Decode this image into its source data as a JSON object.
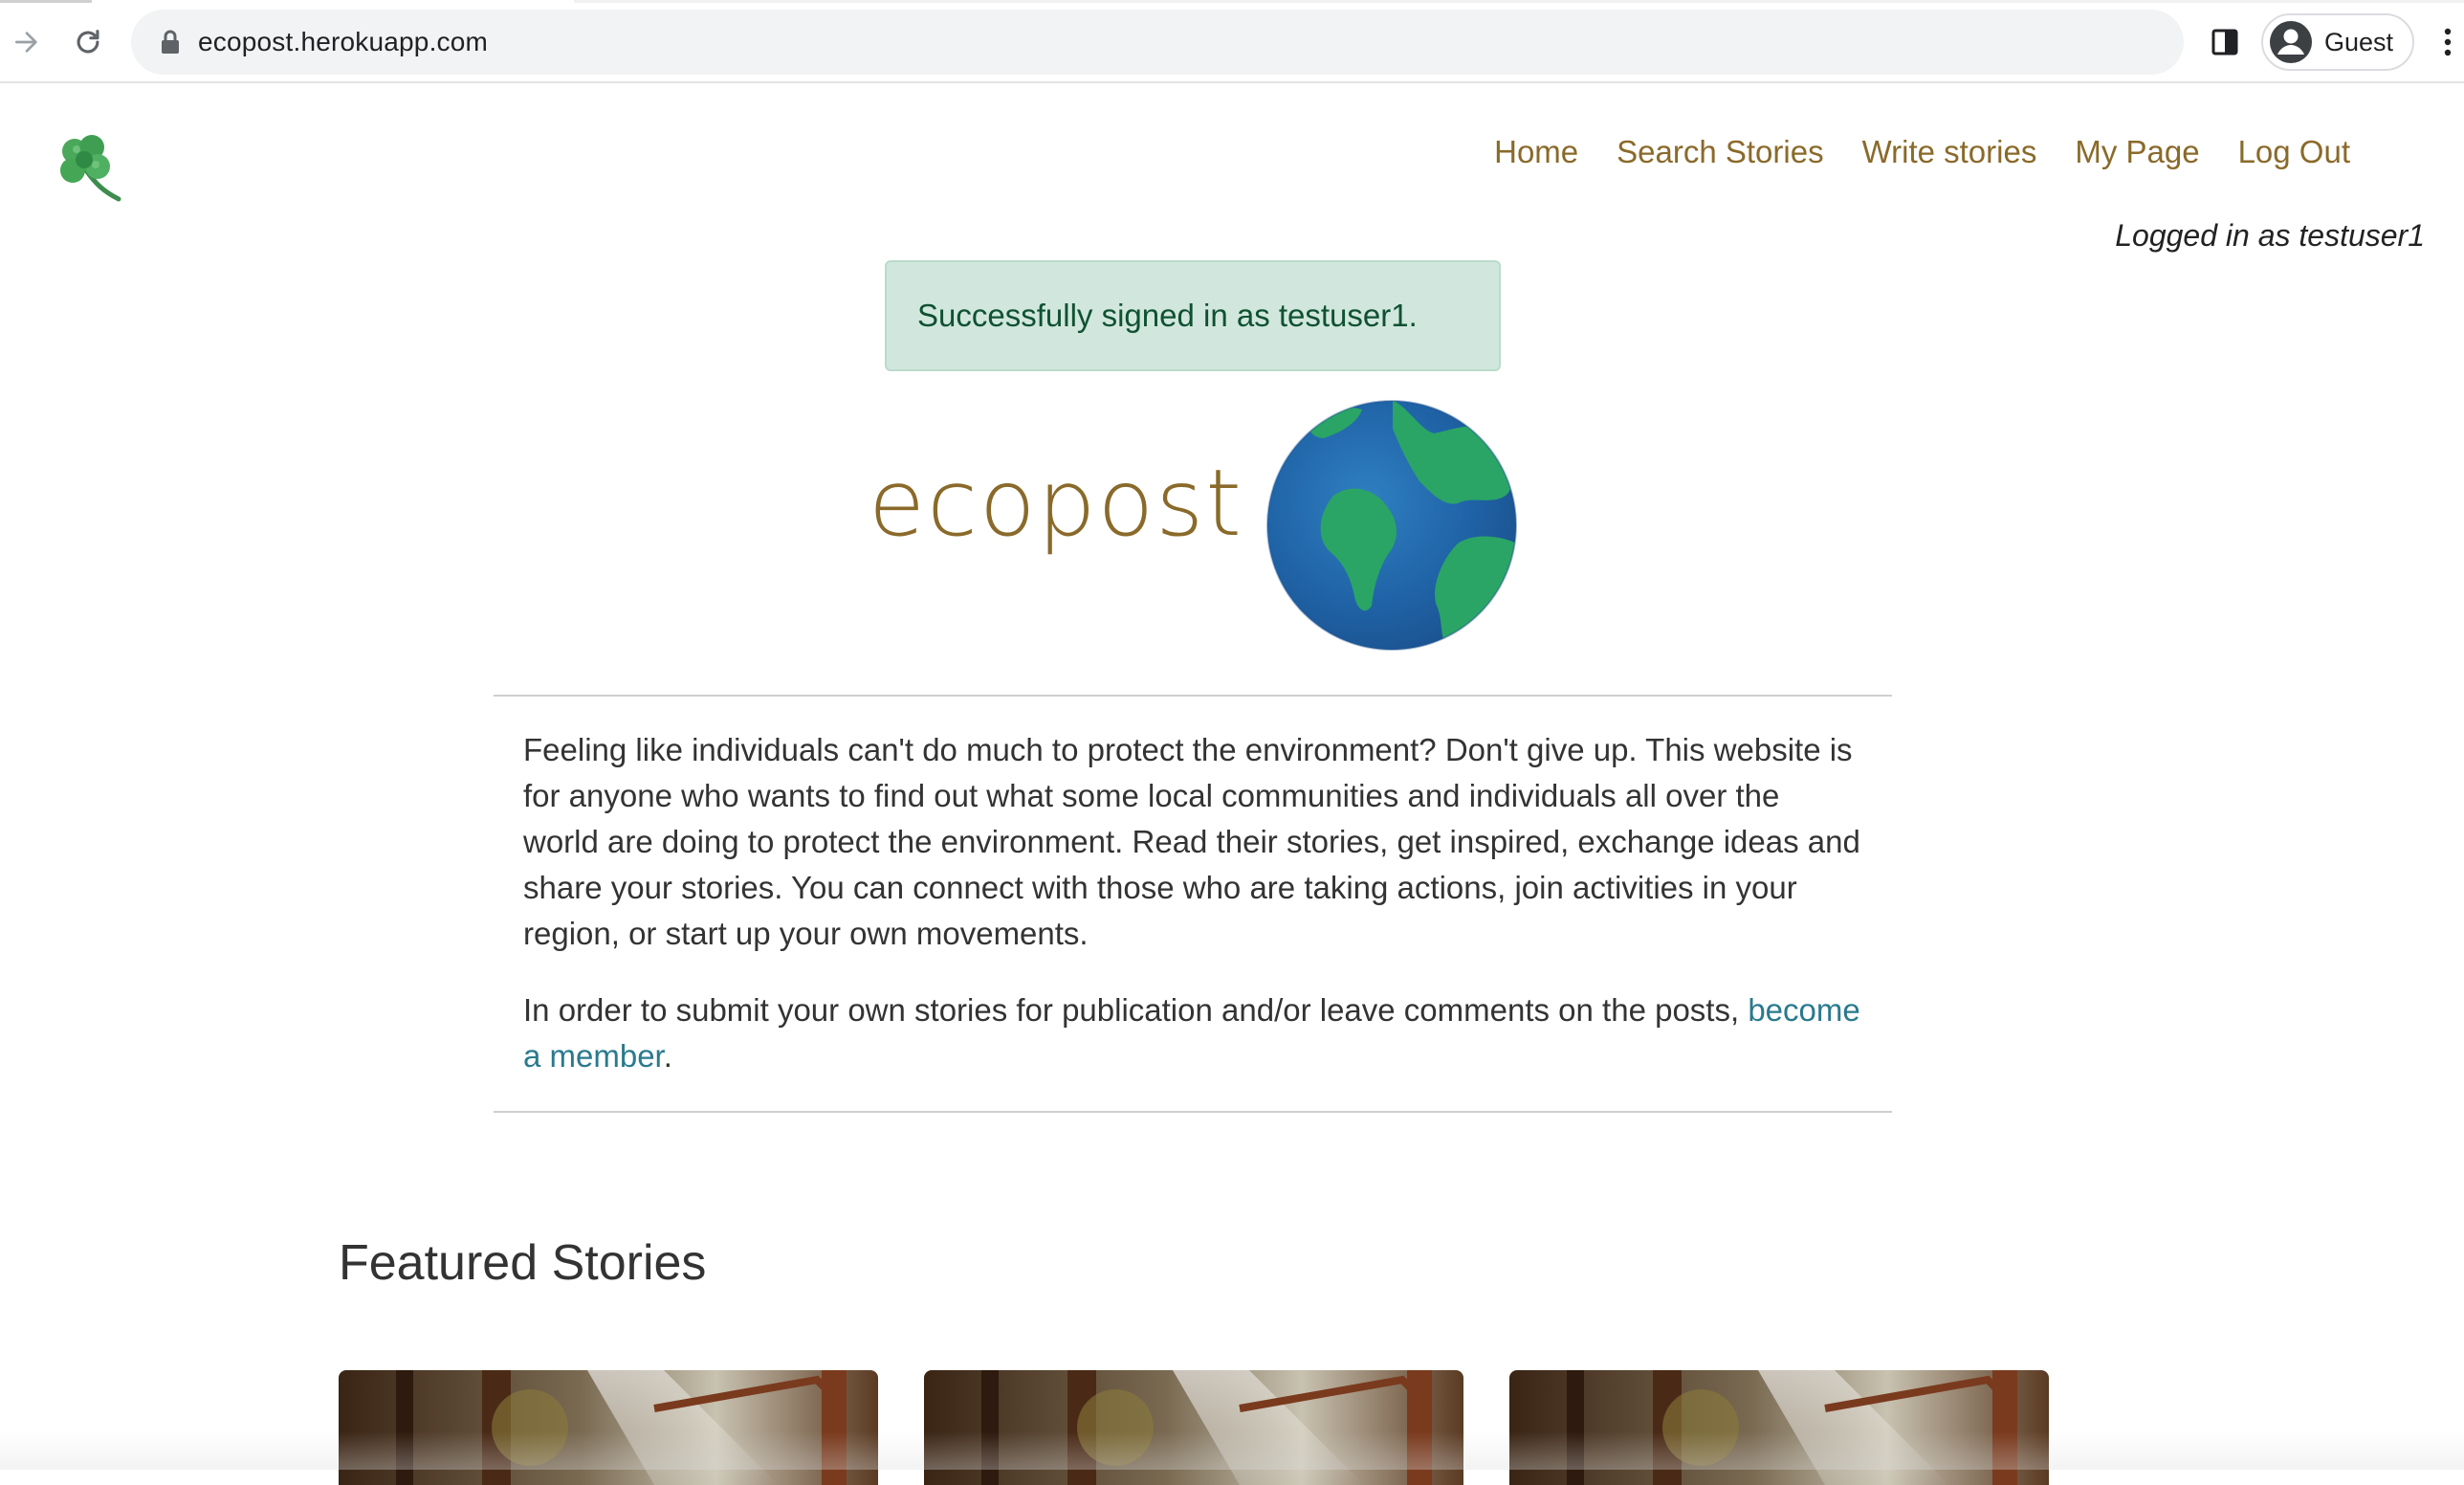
{
  "browser": {
    "url": "ecopost.herokuapp.com",
    "profile_name": "Guest"
  },
  "site": {
    "nav": {
      "home": "Home",
      "search": "Search Stories",
      "write": "Write stories",
      "my_page": "My Page",
      "logout": "Log Out"
    },
    "logged_in": "Logged in as testuser1",
    "alert": "Successfully signed in as testuser1.",
    "wordmark": "ecopost",
    "intro": {
      "p1": "Feeling like individuals can't do much to protect the environment? Don't give up. This website is for anyone who wants to find out what some local communities and individuals all over the world are doing to protect the environment. Read their stories, get inspired, exchange ideas and share your stories. You can connect with those who are taking actions, join activities in your region, or start up your own movements.",
      "p2_before": "In order to submit your own stories for publication and/or leave comments on the posts, ",
      "p2_link": "become a member",
      "p2_after": "."
    },
    "featured_title": "Featured Stories"
  },
  "colors": {
    "nav_link": "#8a6a2a",
    "alert_bg": "#d1e7dd",
    "alert_text": "#0f5132",
    "link": "#2a7a8e"
  },
  "icons": {
    "back": "arrow-right-icon",
    "reload": "reload-icon",
    "lock": "lock-icon",
    "side_panel": "side-panel-icon",
    "avatar": "account-circle-icon",
    "menu": "kebab-menu-icon",
    "logo": "clover-icon",
    "globe": "globe-icon"
  }
}
